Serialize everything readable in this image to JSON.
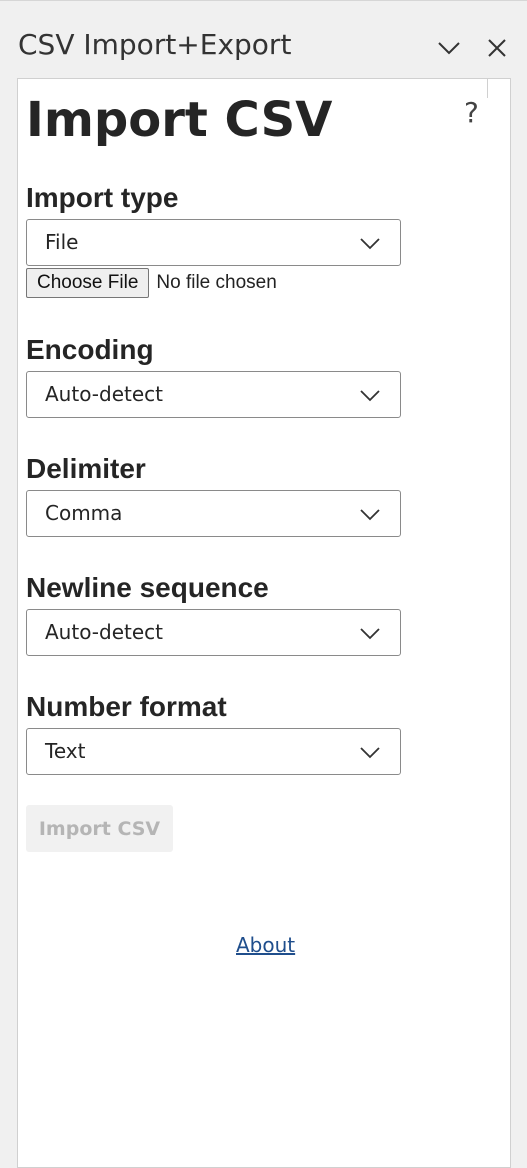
{
  "pane": {
    "title": "CSV Import+Export",
    "collapse_icon": "chevron-down-icon",
    "close_icon": "close-icon"
  },
  "main": {
    "heading": "Import CSV",
    "help_label": "?"
  },
  "form": {
    "import_type": {
      "label": "Import type",
      "value": "File"
    },
    "file": {
      "button_label": "Choose File",
      "status": "No file chosen"
    },
    "encoding": {
      "label": "Encoding",
      "value": "Auto-detect"
    },
    "delimiter": {
      "label": "Delimiter",
      "value": "Comma"
    },
    "newline": {
      "label": "Newline sequence",
      "value": "Auto-detect"
    },
    "number_format": {
      "label": "Number format",
      "value": "Text"
    }
  },
  "actions": {
    "import_label": "Import CSV",
    "about_label": "About"
  },
  "colors": {
    "link": "#1f4e8c",
    "disabled_text": "#b5b5b5",
    "pane_bg": "#f0f0f0"
  }
}
